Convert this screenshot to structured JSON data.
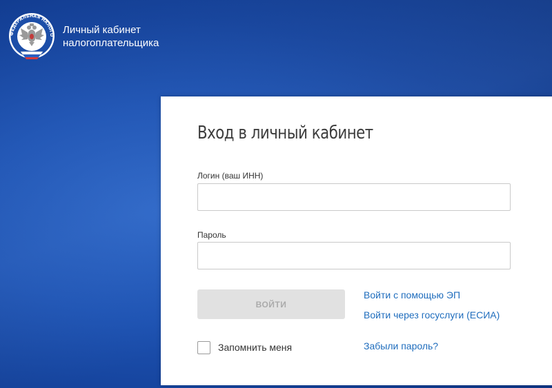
{
  "header": {
    "logo_name": "fns-emblem",
    "logo_ring_text": "ФЕДЕРАЛЬНАЯ НАЛОГОВАЯ СЛУЖБА",
    "title_line1": "Личный кабинет",
    "title_line2": "налогоплательщика"
  },
  "login_form": {
    "title": "Вход в личный кабинет",
    "login_label": "Логин (ваш ИНН)",
    "login_value": "",
    "password_label": "Пароль",
    "password_value": "",
    "submit_label": "ВОЙТИ",
    "remember_label": "Запомнить меня",
    "remember_checked": false,
    "links": {
      "ep": "Войти с помощью ЭП",
      "esia": "Войти через госуслуги (ЕСИА)",
      "forgot": "Забыли пароль?"
    }
  },
  "colors": {
    "background": "#1d52b2",
    "link": "#1f6dbd",
    "button_disabled": "#e1e1e1"
  }
}
